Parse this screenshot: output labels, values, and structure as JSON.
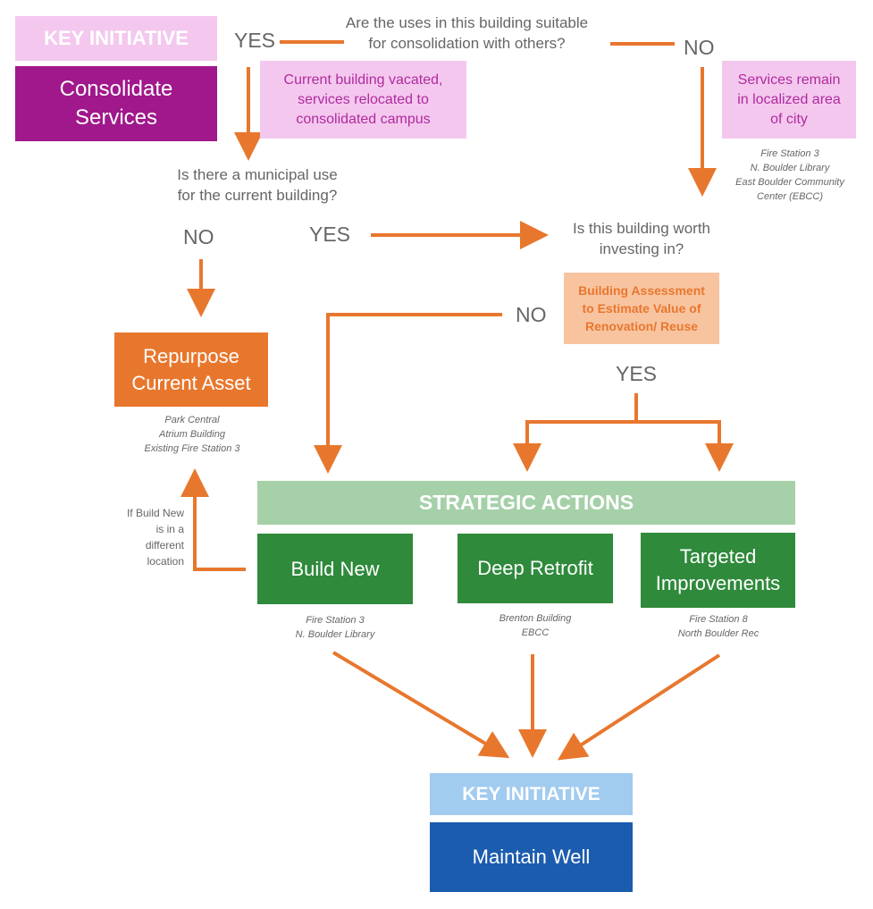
{
  "colors": {
    "arrow": "#e8772e",
    "pink_light": "#f4c8ee",
    "purple": "#a0188c",
    "orange": "#e8772e",
    "peach": "#f8c4a0",
    "green_light": "#a5d0a8",
    "green": "#2f8a3b",
    "blue_light": "#a2cbf0",
    "blue": "#1c5cae"
  },
  "top_initiative": {
    "label": "KEY INITIATIVE",
    "title": "Consolidate Services"
  },
  "q1": {
    "text": "Are the uses in this building suitable for consolidation with others?",
    "yes": "YES",
    "no": "NO"
  },
  "yes_result": "Current building vacated, services relocated to consolidated campus",
  "no_result": "Services remain in localized area of city",
  "no_examples": [
    "Fire Station 3",
    "N. Boulder Library",
    "East Boulder Community",
    "Center (EBCC)"
  ],
  "q2": {
    "text": "Is there a municipal use for the current building?",
    "no": "NO",
    "yes": "YES"
  },
  "q3": {
    "text": "Is this building worth investing in?",
    "no": "NO",
    "yes": "YES"
  },
  "assessment": "Building Assessment to Estimate Value of Renovation/ Reuse",
  "repurpose": {
    "title": "Repurpose Current Asset",
    "examples": [
      "Park Central",
      "Atrium Building",
      "Existing Fire Station 3"
    ]
  },
  "build_new_note": "If Build New is in a different location",
  "strategic": {
    "header": "STRATEGIC ACTIONS",
    "actions": [
      {
        "title": "Build New",
        "examples": [
          "Fire Station 3",
          "N. Boulder Library"
        ]
      },
      {
        "title": "Deep Retrofit",
        "examples": [
          "Brenton Building",
          "EBCC"
        ]
      },
      {
        "title": "Targeted Improvements",
        "examples": [
          "Fire Station 8",
          "North Boulder Rec"
        ]
      }
    ]
  },
  "bottom_initiative": {
    "label": "KEY INITIATIVE",
    "title": "Maintain Well"
  }
}
